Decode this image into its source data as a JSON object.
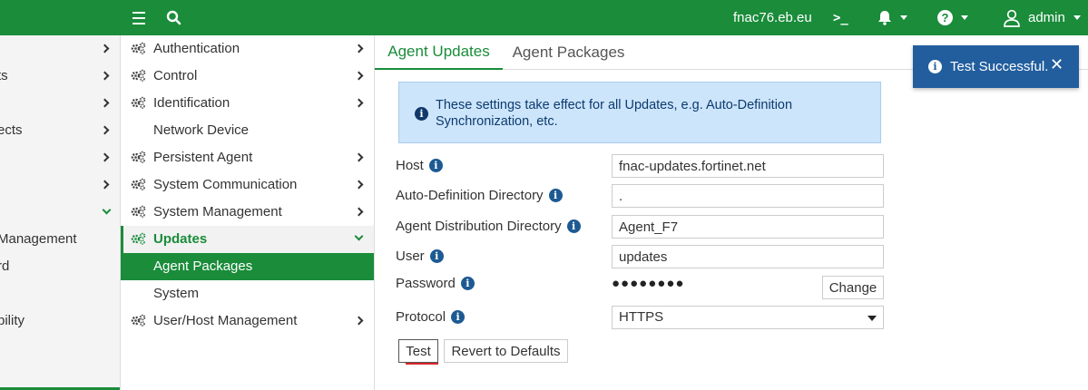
{
  "topbar": {
    "host": "fnac76.eb.eu",
    "terminal_glyph": ">_",
    "user": "admin"
  },
  "left_column": {
    "items": [
      {
        "label": "",
        "has_chevron": true
      },
      {
        "label": "ts",
        "has_chevron": true
      },
      {
        "label": "",
        "has_chevron": true
      },
      {
        "label": "ects",
        "has_chevron": true
      },
      {
        "label": "",
        "has_chevron": true
      },
      {
        "label": "",
        "has_chevron": true
      },
      {
        "label": "",
        "has_chevron": true,
        "expanded": true
      },
      {
        "label": "Management",
        "has_chevron": false
      },
      {
        "label": "rd",
        "has_chevron": false
      },
      {
        "label": "",
        "has_chevron": false
      },
      {
        "label": "bility",
        "has_chevron": false
      }
    ]
  },
  "menu": {
    "items": [
      {
        "label": "Authentication",
        "icon": "gears-icon"
      },
      {
        "label": "Control",
        "icon": "gears-icon"
      },
      {
        "label": "Identification",
        "icon": "gears-icon"
      },
      {
        "label": "Network Device"
      },
      {
        "label": "Persistent Agent",
        "icon": "gears-icon"
      },
      {
        "label": "System Communication",
        "icon": "gears-icon"
      },
      {
        "label": "System Management",
        "icon": "gears-icon"
      },
      {
        "label": "Updates",
        "icon": "gears-icon",
        "expanded": true
      },
      {
        "label": "Agent Packages",
        "selected": true
      },
      {
        "label": "System"
      },
      {
        "label": "User/Host Management",
        "icon": "gears-icon"
      }
    ]
  },
  "tabs": [
    {
      "label": "Agent Updates",
      "active": true
    },
    {
      "label": "Agent Packages",
      "active": false
    }
  ],
  "info": {
    "text": "These settings take effect for all Updates, e.g. Auto-Definition Synchronization, etc."
  },
  "form": {
    "host_label": "Host",
    "host_value": "fnac-updates.fortinet.net",
    "autodef_label": "Auto-Definition Directory",
    "autodef_value": ".",
    "agentdist_label": "Agent Distribution Directory",
    "agentdist_value": "Agent_F7",
    "user_label": "User",
    "user_value": "updates",
    "password_label": "Password",
    "password_mask": "●●●●●●●●",
    "change_label": "Change",
    "protocol_label": "Protocol",
    "protocol_value": "HTTPS",
    "test_label": "Test",
    "revert_label": "Revert to Defaults"
  },
  "toast": {
    "message": "Test Successful.",
    "close_glyph": "✕"
  },
  "colors": {
    "brand": "#1a8c3a",
    "info_bg": "#cce5fb",
    "toast_bg": "#225e9e"
  }
}
